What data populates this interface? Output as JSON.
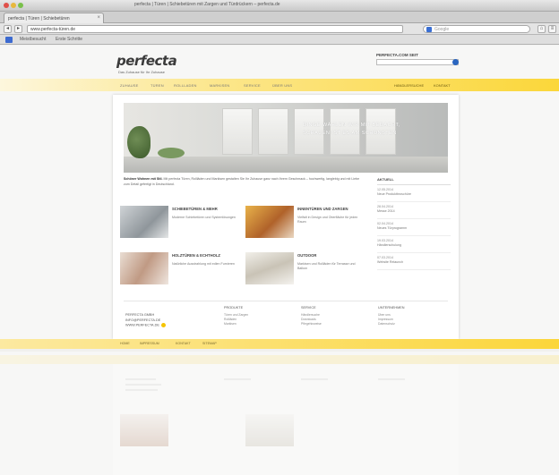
{
  "browser": {
    "window_title": "perfecta | Türen | Schiebetüren mit Zargen und Türdrückern – perfecta.de",
    "tab_title": "perfecta | Türen | Schiebetüren",
    "url": "www.perfecta-türen.de",
    "search_placeholder": "Google",
    "bookmarks": [
      "Meistbesucht",
      "Erste Schritte"
    ]
  },
  "header": {
    "logo": "perfecta",
    "tagline": "Das Zuhause für Ihr Zuhause",
    "search_label": "PERFECTA.COM SEIT",
    "search_placeholder": ""
  },
  "menu": {
    "items": [
      "ZUHAUSE",
      "TÜREN",
      "ROLLLADEN",
      "MARKISEN",
      "SERVICE",
      "ÜBER UNS"
    ],
    "right_items": [
      "HÄNDLERSUCHE",
      "KONTAKT"
    ]
  },
  "hero": {
    "line1": "DINGE WÄHLEN WIR MIT BEDACHT,",
    "line2": "SCHAUEN IST ES AM SCHÖNSTEN"
  },
  "intro": {
    "bold": "Schöner Wohnen mit Stil.",
    "text": " Mit perfecta Türen, Rollläden und Markisen gestalten Sie Ihr Zuhause ganz nach Ihrem Geschmack – hochwertig, langlebig und mit Liebe zum Detail gefertigt in Deutschland."
  },
  "teasers": [
    {
      "title": "SCHIEBETÜREN & MEHR",
      "text": "Moderne Schiebetüren und Systemlösungen"
    },
    {
      "title": "INNENTÜREN UND ZARGEN",
      "text": "Vielfalt in Design und Oberfläche für jeden Raum"
    },
    {
      "title": "HOLZTÜREN & ECHTHOLZ",
      "text": "Natürliche Ausstrahlung mit edlen Furnieren"
    },
    {
      "title": "OUTDOOR",
      "text": "Markisen und Rollläden für Terrasse und Balkon"
    }
  ],
  "aside": {
    "heading": "AKTUELL",
    "news": [
      {
        "date": "12.05.2014",
        "title": "Neue Produktbroschüre"
      },
      {
        "date": "28.04.2014",
        "title": "Messe 2014"
      },
      {
        "date": "02.04.2014",
        "title": "Neues Türprogramm"
      },
      {
        "date": "19.03.2014",
        "title": "Händlerschulung"
      },
      {
        "date": "07.03.2014",
        "title": "Website Relaunch"
      }
    ]
  },
  "footer": {
    "contact_lines": [
      "PERFECTA GMBH",
      "INFO@PERFECTA.DE",
      "WWW.PERFECTA.DE"
    ],
    "columns": [
      {
        "heading": "PRODUKTE",
        "items": [
          "Türen und Zargen",
          "Rollläden",
          "Markisen"
        ]
      },
      {
        "heading": "SERVICE",
        "items": [
          "Händlersuche",
          "Downloads",
          "Pflegehinweise"
        ]
      },
      {
        "heading": "UNTERNEHMEN",
        "items": [
          "Über uns",
          "Impressum",
          "Datenschutz"
        ]
      }
    ]
  },
  "bottombar": {
    "items": [
      "HOME",
      "IMPRESSUM",
      "KONTAKT",
      "SITEMAP"
    ]
  }
}
